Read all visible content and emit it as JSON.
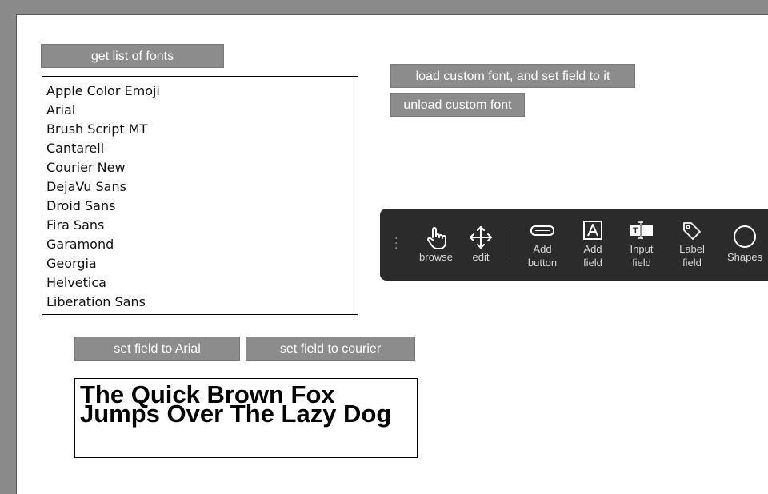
{
  "buttons": {
    "get_fonts": "get list of fonts",
    "load_custom": "load custom font, and set field to it",
    "unload_custom": "unload custom font",
    "set_arial": "set field to Arial",
    "set_courier": "set field to courier"
  },
  "font_list": [
    "Apple Color Emoji",
    "Arial",
    "Brush Script MT",
    "Cantarell",
    "Courier New",
    "DejaVu Sans",
    "Droid Sans",
    "Fira Sans",
    "Garamond",
    "Georgia",
    "Helvetica",
    "Liberation Sans"
  ],
  "field": {
    "text": "The Quick Brown Fox Jumps Over The Lazy Dog"
  },
  "toolbar": {
    "tools": [
      {
        "label": "browse",
        "icon": "hand-pointer-icon"
      },
      {
        "label": "edit",
        "icon": "move-arrows-icon"
      },
      {
        "label": "Add\nbutton",
        "icon": "button-outline-icon"
      },
      {
        "label": "Add\nfield",
        "icon": "letter-a-box-icon"
      },
      {
        "label": "Input\nfield",
        "icon": "text-input-icon"
      },
      {
        "label": "Label\nfield",
        "icon": "tag-icon"
      },
      {
        "label": "Shapes",
        "icon": "circle-icon"
      }
    ]
  },
  "colors": {
    "background": "#8a8a8a",
    "button": "#8c8c8c",
    "toolbar": "#2b2b2b",
    "toolbar_text": "#d6d6d6"
  }
}
